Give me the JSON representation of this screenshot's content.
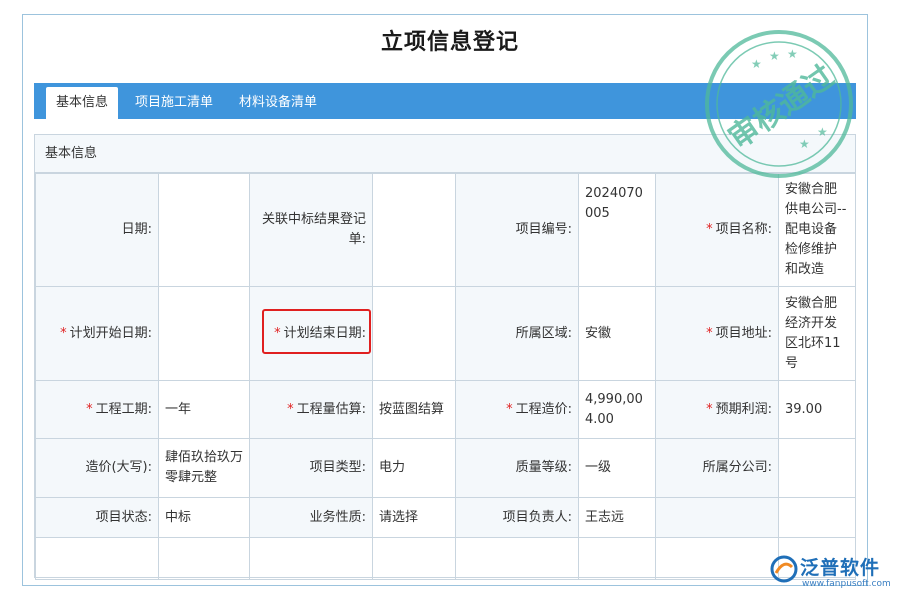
{
  "page": {
    "title": "立项信息登记"
  },
  "tabs": [
    {
      "label": "基本信息",
      "active": true
    },
    {
      "label": "项目施工清单",
      "active": false
    },
    {
      "label": "材料设备清单",
      "active": false
    }
  ],
  "panel": {
    "header": "基本信息"
  },
  "form": {
    "row1": {
      "l1": "日期:",
      "v1": "",
      "l2": "关联中标结果登记单:",
      "v2": "",
      "l3": "项目编号:",
      "v3": "2024070005",
      "l4": "项目名称:",
      "v4": "安徽合肥供电公司--配电设备检修维护和改造"
    },
    "row2": {
      "l1": "计划开始日期:",
      "v1": "",
      "l2": "计划结束日期:",
      "v2": "",
      "l3": "所属区域:",
      "v3": "安徽",
      "l4": "项目地址:",
      "v4": "安徽合肥经济开发区北环11号"
    },
    "row3": {
      "l1": "工程工期:",
      "v1": "一年",
      "l2": "工程量估算:",
      "v2": "按蓝图结算",
      "l3": "工程造价:",
      "v3": "4,990,004.00",
      "l4": "预期利润:",
      "v4": "39.00"
    },
    "row4": {
      "l1": "造价(大写):",
      "v1": "肆佰玖拾玖万零肆元整",
      "l2": "项目类型:",
      "v2": "电力",
      "l3": "质量等级:",
      "v3": "一级",
      "l4": "所属分公司:",
      "v4": ""
    },
    "row5": {
      "l1": "项目状态:",
      "v1": "中标",
      "l2": "业务性质:",
      "v2": "请选择",
      "l3": "项目负责人:",
      "v3": "王志远",
      "l4": "",
      "v4": ""
    }
  },
  "required_mark": "*",
  "stamp": {
    "text": "审核通过",
    "color": "#4fb99a"
  },
  "logo": {
    "name": "泛普软件",
    "url": "www.fanpusoft.com",
    "color": "#1f6fb8"
  },
  "colors": {
    "tab_bar": "#3f95dc",
    "required": "#e02020",
    "highlight": "#e02020",
    "label_bg": "#f4f8fb",
    "border": "#c9d5df"
  }
}
